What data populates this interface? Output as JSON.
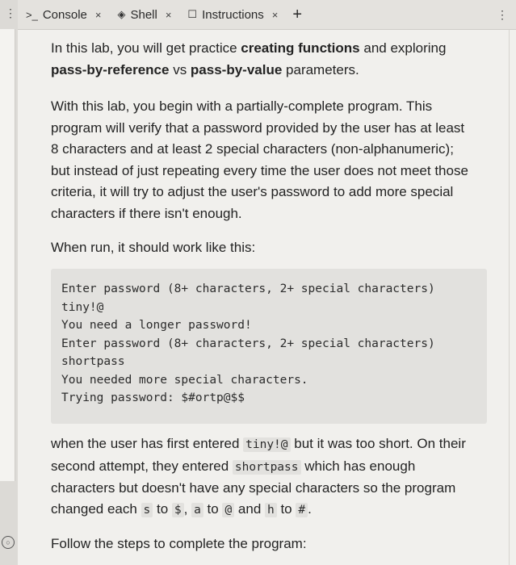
{
  "tabs": [
    {
      "icon": "terminal-icon",
      "glyph": ">_",
      "label": "Console",
      "close": "×"
    },
    {
      "icon": "shell-icon",
      "glyph": "◈",
      "label": "Shell",
      "close": "×"
    },
    {
      "icon": "book-icon",
      "glyph": "☐",
      "label": "Instructions",
      "close": "×"
    }
  ],
  "add_tab": "+",
  "menu": "⋮",
  "content": {
    "p1": {
      "t1": "In this lab, you will get practice ",
      "b1": "creating functions",
      "t2": " and exploring ",
      "b2": "pass-by-reference",
      "t3": " vs ",
      "b3": "pass-by-value",
      "t4": " parameters."
    },
    "p2": "With this lab, you begin with a partially-complete program. This program will verify that a password provided by the user has at least 8 characters and at least 2 special characters (non-alphanumeric); but instead of just repeating every time the user does not meet those criteria, it will try to adjust the user's password to add more special characters if there isn't enough.",
    "p3": "When run, it should work like this:",
    "code": [
      "Enter password (8+ characters, 2+ special characters)",
      "tiny!@",
      "You need a longer password!",
      "Enter password (8+ characters, 2+ special characters)",
      "shortpass",
      "You needed more special characters.",
      "Trying password: $#ortp@$$"
    ],
    "p4": {
      "t1": "when the user has first entered ",
      "c1": "tiny!@",
      "t2": " but it was too short. On their second attempt, they entered ",
      "c2": "shortpass",
      "t3": " which has enough characters but doesn't have any special characters so the program changed each ",
      "c3": "s",
      "t4": " to ",
      "c4": "$",
      "t5": ", ",
      "c5": "a",
      "t6": " to ",
      "c6": "@",
      "t7": " and ",
      "c7": "h",
      "t8": " to ",
      "c8": "#",
      "t9": "."
    },
    "p5": "Follow the steps to complete the program:"
  }
}
